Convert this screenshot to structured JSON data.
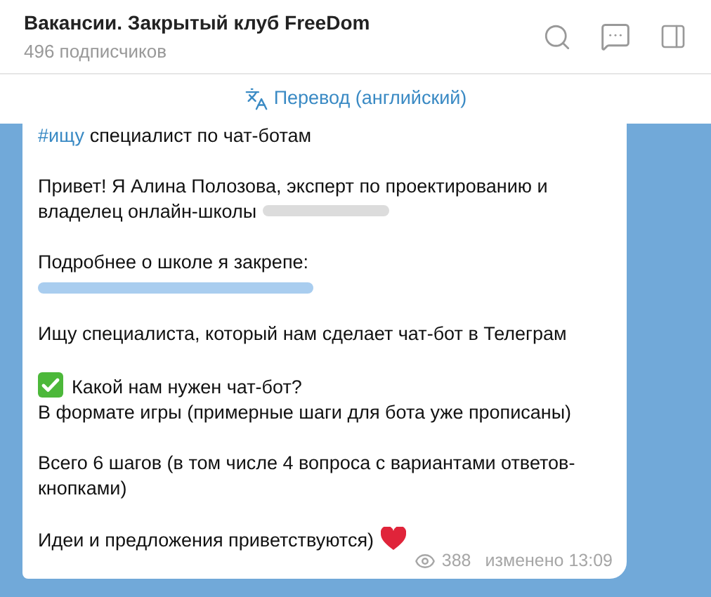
{
  "header": {
    "title": "Вакансии. Закрытый клуб FreeDom",
    "subtitle": "496 подписчиков"
  },
  "translate_bar": {
    "label": "Перевод (английский)"
  },
  "message": {
    "paragraphs": [
      {
        "kind": "text",
        "hashtag": "#ищу",
        "lines": [
          "специалист по чат-ботам"
        ]
      },
      {
        "kind": "text",
        "lines": [
          "Привет! Я Алина Полозова, эксперт по проектированию и",
          "владелец онлайн-школы"
        ],
        "redacted_tail": true
      },
      {
        "kind": "text_with_redacted_link",
        "lines": [
          "Подробнее о школе я закрепе:"
        ]
      },
      {
        "kind": "text",
        "lines": [
          "Ищу специалиста, который нам сделает чат-бот в Телеграм"
        ]
      },
      {
        "kind": "check_text",
        "lines": [
          "Какой нам нужен чат-бот?",
          "В формате игры (примерные шаги для бота уже прописаны)"
        ]
      },
      {
        "kind": "text",
        "lines": [
          "Всего 6 шагов (в том числе 4 вопроса с вариантами ответов-",
          "кнопками)"
        ]
      },
      {
        "kind": "heart_text",
        "lines": [
          "Идеи и предложения приветствуются)"
        ]
      }
    ],
    "views": "388",
    "edited": "изменено 13:09"
  }
}
